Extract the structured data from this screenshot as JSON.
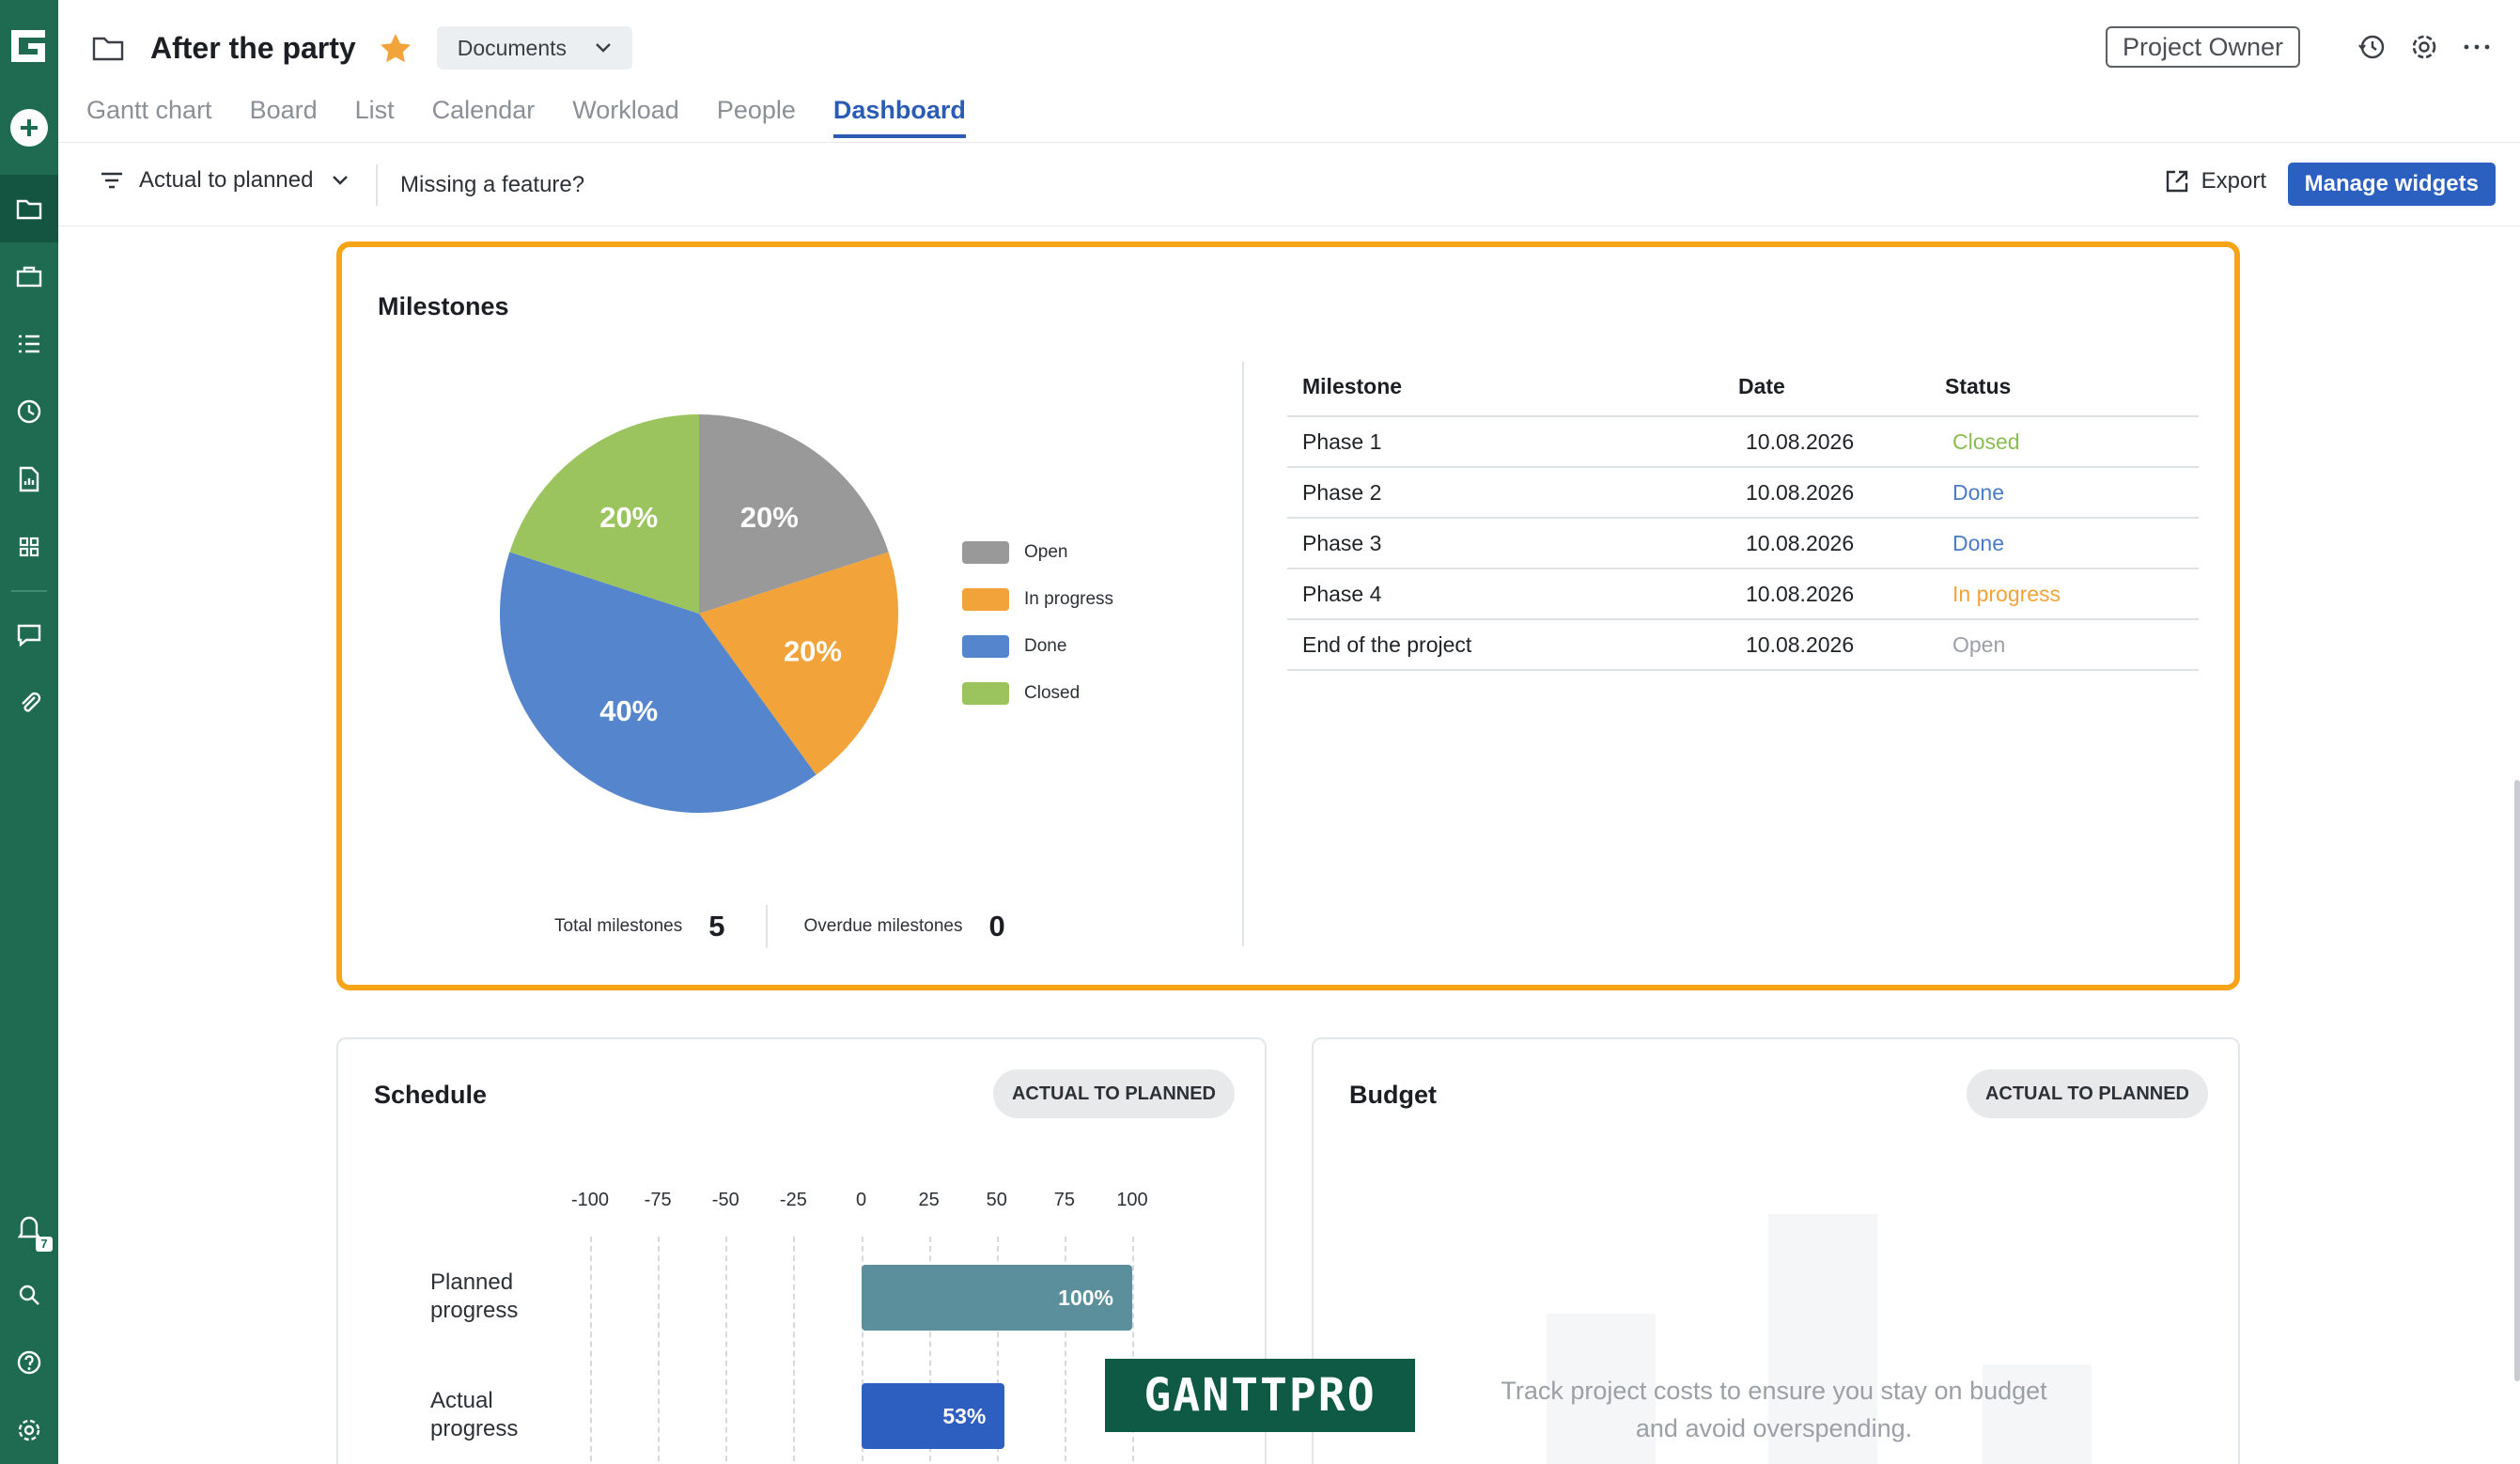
{
  "project": {
    "title": "After the party",
    "documents_label": "Documents",
    "role": "Project Owner"
  },
  "tabs": [
    {
      "label": "Gantt chart"
    },
    {
      "label": "Board"
    },
    {
      "label": "List"
    },
    {
      "label": "Calendar"
    },
    {
      "label": "Workload"
    },
    {
      "label": "People"
    },
    {
      "label": "Dashboard",
      "active": true
    }
  ],
  "toolbar": {
    "filter_label": "Actual to planned",
    "missing_label": "Missing a feature?",
    "export_label": "Export",
    "manage_label": "Manage widgets"
  },
  "rail": {
    "notifications_count": "7"
  },
  "milestones": {
    "title": "Milestones",
    "legend": [
      {
        "label": "Open",
        "color": "#999999"
      },
      {
        "label": "In progress",
        "color": "#f2a33a"
      },
      {
        "label": "Done",
        "color": "#5585cc"
      },
      {
        "label": "Closed",
        "color": "#9bc45e"
      }
    ],
    "total_label": "Total milestones",
    "total_value": "5",
    "overdue_label": "Overdue milestones",
    "overdue_value": "0",
    "table": {
      "headers": [
        "Milestone",
        "Date",
        "Status"
      ],
      "rows": [
        {
          "name": "Phase 1",
          "date": "10.08.2026",
          "status": "Closed",
          "color": "#8bbd52"
        },
        {
          "name": "Phase 2",
          "date": "10.08.2026",
          "status": "Done",
          "color": "#4a7cc6"
        },
        {
          "name": "Phase 3",
          "date": "10.08.2026",
          "status": "Done",
          "color": "#4a7cc6"
        },
        {
          "name": "Phase 4",
          "date": "10.08.2026",
          "status": "In progress",
          "color": "#f2a33a"
        },
        {
          "name": "End of the project",
          "date": "10.08.2026",
          "status": "Open",
          "color": "#9aa0a6"
        }
      ]
    }
  },
  "chart_data": [
    {
      "type": "pie",
      "title": "",
      "slices": [
        {
          "name": "Open",
          "value": 20,
          "label": "20%",
          "color": "#999999"
        },
        {
          "name": "In progress",
          "value": 20,
          "label": "20%",
          "color": "#f2a33a"
        },
        {
          "name": "Done",
          "value": 40,
          "label": "40%",
          "color": "#5585cc"
        },
        {
          "name": "Closed",
          "value": 20,
          "label": "20%",
          "color": "#9bc45e"
        }
      ]
    },
    {
      "type": "bar",
      "orientation": "horizontal",
      "title": "",
      "categories": [
        "Planned progress",
        "Actual progress"
      ],
      "values": [
        100,
        53
      ],
      "value_labels": [
        "100%",
        "53%"
      ],
      "colors": [
        "#5b8f9c",
        "#2c5fbf"
      ],
      "xlim": [
        -100,
        100
      ],
      "xticks": [
        "-100",
        "-75",
        "-50",
        "-25",
        "0",
        "25",
        "50",
        "75",
        "100"
      ]
    }
  ],
  "schedule": {
    "title": "Schedule",
    "pill": "ACTUAL TO PLANNED",
    "rows": [
      [
        "Planned",
        "progress"
      ],
      [
        "Actual",
        "progress"
      ]
    ]
  },
  "budget": {
    "title": "Budget",
    "pill": "ACTUAL TO PLANNED",
    "message_1": "Track project costs to ensure you stay on budget",
    "message_2": "and avoid overspending."
  },
  "watermark": "GANTTPRO"
}
